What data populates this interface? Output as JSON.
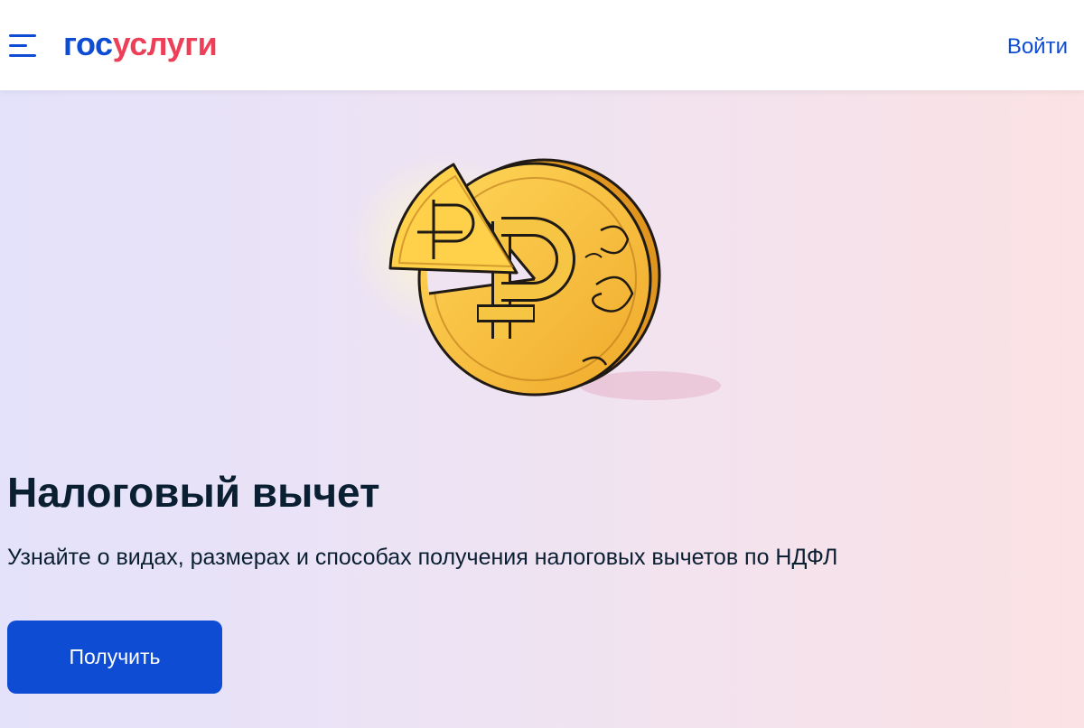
{
  "header": {
    "logo": {
      "part1": "гос",
      "part2": "услуги"
    },
    "login_label": "Войти",
    "menu_icon": "hamburger-menu-icon"
  },
  "hero": {
    "illustration": "ruble-coin-illustration",
    "title": "Налоговый вычет",
    "subtitle": "Узнайте о видах, размерах и способах получения налоговых вычетов по НДФЛ",
    "button_label": "Получить"
  },
  "colors": {
    "brand_blue": "#0d4cd3",
    "brand_red": "#ee3f58",
    "text_dark": "#0b1f33",
    "coin_gold": "#f5bd3a"
  }
}
